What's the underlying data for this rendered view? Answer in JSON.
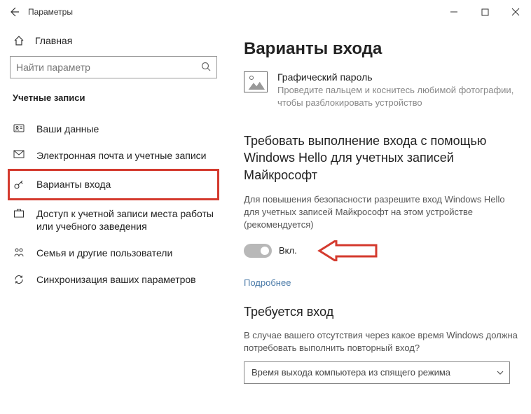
{
  "titlebar": {
    "title": "Параметры"
  },
  "sidebar": {
    "home": "Главная",
    "searchPlaceholder": "Найти параметр",
    "category": "Учетные записи",
    "items": [
      {
        "label": "Ваши данные",
        "icon": "user"
      },
      {
        "label": "Электронная почта и учетные записи",
        "icon": "mail"
      },
      {
        "label": "Варианты входа",
        "icon": "key"
      },
      {
        "label": "Доступ к учетной записи места работы или учебного заведения",
        "icon": "briefcase"
      },
      {
        "label": "Семья и другие пользователи",
        "icon": "family"
      },
      {
        "label": "Синхронизация ваших параметров",
        "icon": "sync"
      }
    ]
  },
  "content": {
    "pageTitle": "Варианты входа",
    "pictureTile": {
      "title": "Графический пароль",
      "desc": "Проведите пальцем и коснитесь любимой фотографии, чтобы разблокировать устройство"
    },
    "helloSection": {
      "heading": "Требовать выполнение входа с помощью Windows Hello для учетных записей Майкрософт",
      "desc": "Для повышения безопасности разрешите вход Windows Hello для учетных записей Майкрософт на этом устройстве (рекомендуется)",
      "toggleLabel": "Вкл.",
      "learnMore": "Подробнее"
    },
    "requireSignin": {
      "heading": "Требуется вход",
      "desc": "В случае вашего отсутствия через какое время Windows должна потребовать выполнить повторный вход?",
      "dropdownValue": "Время выхода компьютера из спящего режима"
    }
  }
}
